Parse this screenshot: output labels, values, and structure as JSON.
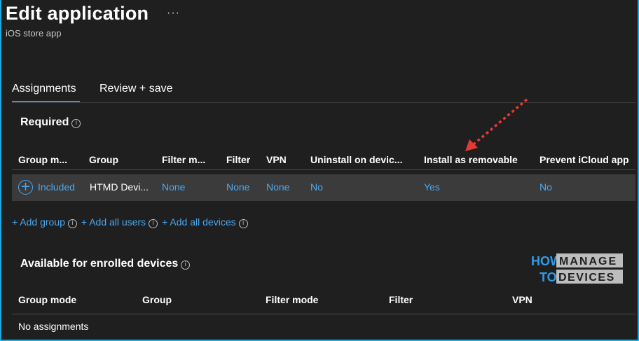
{
  "header": {
    "title": "Edit application",
    "more_icon": "ellipsis-icon",
    "subtitle": "iOS store app"
  },
  "tabs": [
    {
      "label": "Assignments",
      "active": true
    },
    {
      "label": "Review + save",
      "active": false
    }
  ],
  "required": {
    "title": "Required",
    "columns": [
      "Group m...",
      "Group",
      "Filter m...",
      "Filter",
      "VPN",
      "Uninstall on devic...",
      "Install as removable",
      "Prevent iCloud app"
    ],
    "rows": [
      {
        "group_mode": "Included",
        "group": "HTMD Devi...",
        "filter_mode": "None",
        "filter": "None",
        "vpn": "None",
        "uninstall": "No",
        "install_removable": "Yes",
        "prevent_icloud": "No"
      }
    ],
    "actions": [
      "+ Add group",
      "+ Add all users",
      "+ Add all devices"
    ]
  },
  "available": {
    "title": "Available for enrolled devices",
    "columns": [
      "Group mode",
      "Group",
      "Filter mode",
      "Filter",
      "VPN"
    ],
    "empty_text": "No assignments"
  },
  "logo": {
    "line1_left": "HOW",
    "line1_right": "MANAGE",
    "line2_left": "TO",
    "line2_right": "DEVICES"
  },
  "colors": {
    "background": "#1f1f1f",
    "link": "#4aa8f0",
    "accent": "#2899f5",
    "annotation_arrow": "#e53935",
    "frame": "#17a9e0"
  }
}
